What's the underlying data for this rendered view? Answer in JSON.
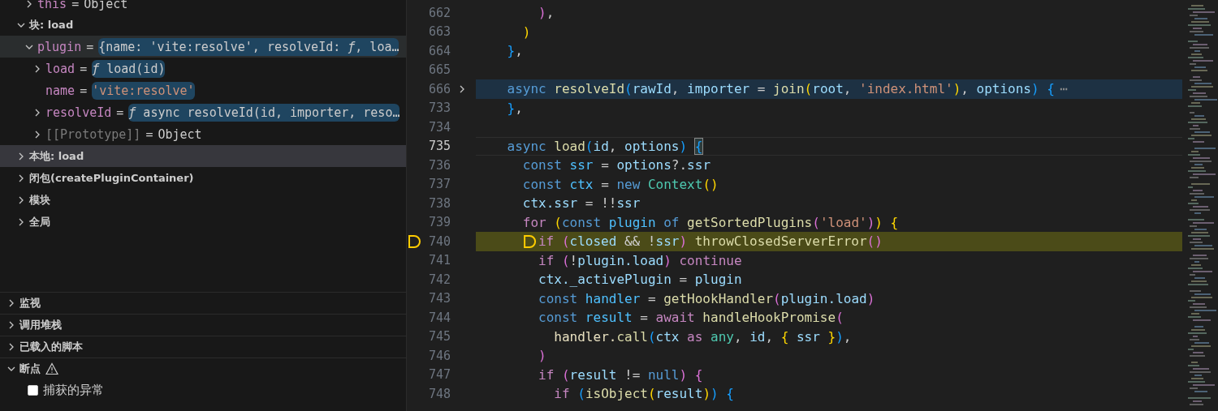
{
  "variables": {
    "previous_scope_rows": [
      {
        "kind": "object",
        "name": "this",
        "operator": "=",
        "value": "Object",
        "expanded": false,
        "highlighted": false
      }
    ],
    "rows": [
      {
        "kind": "scope",
        "label": "块: load",
        "expanded": true,
        "selected": false,
        "children": [
          {
            "kind": "object",
            "name": "plugin",
            "operator": "=",
            "value": "{name: 'vite:resolve', resolveId: *ƒ*, loa…",
            "expanded": true,
            "highlighted": true,
            "hovered": true,
            "children": [
              {
                "kind": "function",
                "name": "load",
                "operator": "=",
                "value": "*ƒ* load(id)",
                "expanded": false,
                "highlighted": true,
                "hovered": false
              },
              {
                "kind": "string",
                "name": "name",
                "operator": "=",
                "value": "'vite:resolve'",
                "highlighted": true,
                "hovered": false
              },
              {
                "kind": "function",
                "name": "resolveId",
                "operator": "=",
                "value": "*ƒ* async resolveId(id, importer, reso…",
                "expanded": false,
                "highlighted": true,
                "hovered": false
              },
              {
                "kind": "object",
                "name": "[[Prototype]]",
                "operator": "=",
                "value": "Object",
                "expanded": false,
                "highlighted": false,
                "hovered": false,
                "dim": true
              }
            ]
          }
        ]
      },
      {
        "kind": "scope",
        "label": "本地: load",
        "expanded": false,
        "selected": true
      },
      {
        "kind": "scope",
        "label": "闭包(createPluginContainer)",
        "expanded": false,
        "selected": false
      },
      {
        "kind": "scope",
        "label": "模块",
        "expanded": false,
        "selected": false
      },
      {
        "kind": "scope",
        "label": "全局",
        "expanded": false,
        "selected": false
      }
    ]
  },
  "sections": [
    {
      "title": "监视",
      "expanded": false,
      "warning": false
    },
    {
      "title": "调用堆栈",
      "expanded": false,
      "warning": false
    },
    {
      "title": "已载入的脚本",
      "expanded": false,
      "warning": false
    },
    {
      "title": "断点",
      "expanded": true,
      "warning": true,
      "items": [
        {
          "label": "捕获的异常",
          "checked": false
        }
      ]
    }
  ],
  "editor": {
    "lines": [
      {
        "number": "662",
        "tokens": [
          {
            "text": "        )",
            "color": "#da70d6"
          },
          {
            "text": ",",
            "color": "#cccccc"
          }
        ]
      },
      {
        "number": "663",
        "tokens": [
          {
            "text": "      )",
            "color": "#ffd700"
          }
        ]
      },
      {
        "number": "664",
        "tokens": [
          {
            "text": "    }",
            "color": "#179fff"
          },
          {
            "text": ",",
            "color": "#cccccc"
          }
        ]
      },
      {
        "number": "665"
      },
      {
        "number": "666",
        "folded": true,
        "fold_ellipsis": "⋯",
        "tokens": [
          {
            "text": "    async ",
            "color": "#569cd6"
          },
          {
            "text": "resolveId",
            "color": "#dcdcaa"
          },
          {
            "text": "(",
            "color": "#179fff"
          },
          {
            "text": "rawId",
            "color": "#9cdcfe"
          },
          {
            "text": ", ",
            "color": "#cccccc"
          },
          {
            "text": "importer",
            "color": "#9cdcfe"
          },
          {
            "text": " = ",
            "color": "#cccccc"
          },
          {
            "text": "join",
            "color": "#dcdcaa"
          },
          {
            "text": "(",
            "color": "#ffd700"
          },
          {
            "text": "root",
            "color": "#9cdcfe"
          },
          {
            "text": ", ",
            "color": "#cccccc"
          },
          {
            "text": "'index.html'",
            "color": "#ce9178"
          },
          {
            "text": ")",
            "color": "#ffd700"
          },
          {
            "text": ", ",
            "color": "#cccccc"
          },
          {
            "text": "options",
            "color": "#9cdcfe"
          },
          {
            "text": ") ",
            "color": "#179fff"
          },
          {
            "text": "{",
            "color": "#179fff"
          }
        ]
      },
      {
        "number": "733",
        "tokens": [
          {
            "text": "    }",
            "color": "#179fff"
          },
          {
            "text": ",",
            "color": "#cccccc"
          }
        ]
      },
      {
        "number": "734"
      },
      {
        "number": "735",
        "current": true,
        "tokens": [
          {
            "text": "    async ",
            "color": "#569cd6"
          },
          {
            "text": "load",
            "color": "#dcdcaa"
          },
          {
            "text": "(",
            "color": "#179fff"
          },
          {
            "text": "id",
            "color": "#9cdcfe"
          },
          {
            "text": ", ",
            "color": "#cccccc"
          },
          {
            "text": "options",
            "color": "#9cdcfe"
          },
          {
            "text": ") ",
            "color": "#179fff"
          },
          {
            "text": "{",
            "color": "#179fff",
            "bracket_match": true
          }
        ]
      },
      {
        "number": "736",
        "tokens": [
          {
            "text": "      const ",
            "color": "#569cd6"
          },
          {
            "text": "ssr",
            "color": "#4fc1ff"
          },
          {
            "text": " = ",
            "color": "#cccccc"
          },
          {
            "text": "options",
            "color": "#9cdcfe"
          },
          {
            "text": "?.",
            "color": "#cccccc"
          },
          {
            "text": "ssr",
            "color": "#9cdcfe"
          }
        ]
      },
      {
        "number": "737",
        "tokens": [
          {
            "text": "      const ",
            "color": "#569cd6"
          },
          {
            "text": "ctx",
            "color": "#4fc1ff"
          },
          {
            "text": " = ",
            "color": "#cccccc"
          },
          {
            "text": "new ",
            "color": "#569cd6"
          },
          {
            "text": "Context",
            "color": "#4ec9b0"
          },
          {
            "text": "()",
            "color": "#ffd700"
          }
        ]
      },
      {
        "number": "738",
        "tokens": [
          {
            "text": "      ctx.",
            "color": "#9cdcfe"
          },
          {
            "text": "ssr",
            "color": "#9cdcfe"
          },
          {
            "text": " = !!",
            "color": "#cccccc"
          },
          {
            "text": "ssr",
            "color": "#9cdcfe"
          }
        ]
      },
      {
        "number": "739",
        "tokens": [
          {
            "text": "      for ",
            "color": "#c586c0"
          },
          {
            "text": "(",
            "color": "#ffd700"
          },
          {
            "text": "const ",
            "color": "#569cd6"
          },
          {
            "text": "plugin ",
            "color": "#4fc1ff"
          },
          {
            "text": "of ",
            "color": "#569cd6"
          },
          {
            "text": "getSortedPlugins",
            "color": "#dcdcaa"
          },
          {
            "text": "(",
            "color": "#da70d6"
          },
          {
            "text": "'load'",
            "color": "#ce9178"
          },
          {
            "text": ")",
            "color": "#da70d6"
          },
          {
            "text": ") {",
            "color": "#ffd700"
          }
        ]
      },
      {
        "number": "740",
        "breakpoint": true,
        "paused": true,
        "inline_breakpoint": true,
        "tokens": [
          {
            "text": "      if ",
            "color": "#c586c0"
          },
          {
            "text": "(",
            "color": "#da70d6"
          },
          {
            "text": "closed",
            "color": "#9cdcfe"
          },
          {
            "text": " && !",
            "color": "#cccccc"
          },
          {
            "text": "ssr",
            "color": "#9cdcfe"
          },
          {
            "text": ") ",
            "color": "#da70d6"
          },
          {
            "text": "throwClosedServerError",
            "color": "#dcdcaa"
          },
          {
            "text": "()",
            "color": "#da70d6"
          }
        ]
      },
      {
        "number": "741",
        "tokens": [
          {
            "text": "        if ",
            "color": "#c586c0"
          },
          {
            "text": "(",
            "color": "#da70d6"
          },
          {
            "text": "!",
            "color": "#cccccc"
          },
          {
            "text": "plugin.",
            "color": "#9cdcfe"
          },
          {
            "text": "load",
            "color": "#9cdcfe"
          },
          {
            "text": ") ",
            "color": "#da70d6"
          },
          {
            "text": "continue",
            "color": "#c586c0"
          }
        ]
      },
      {
        "number": "742",
        "tokens": [
          {
            "text": "        ctx.",
            "color": "#9cdcfe"
          },
          {
            "text": "_activePlugin",
            "color": "#9cdcfe"
          },
          {
            "text": " = ",
            "color": "#cccccc"
          },
          {
            "text": "plugin",
            "color": "#9cdcfe"
          }
        ]
      },
      {
        "number": "743",
        "tokens": [
          {
            "text": "        const ",
            "color": "#569cd6"
          },
          {
            "text": "handler",
            "color": "#4fc1ff"
          },
          {
            "text": " = ",
            "color": "#cccccc"
          },
          {
            "text": "getHookHandler",
            "color": "#dcdcaa"
          },
          {
            "text": "(",
            "color": "#da70d6"
          },
          {
            "text": "plugin.",
            "color": "#9cdcfe"
          },
          {
            "text": "load",
            "color": "#9cdcfe"
          },
          {
            "text": ")",
            "color": "#da70d6"
          }
        ]
      },
      {
        "number": "744",
        "tokens": [
          {
            "text": "        const ",
            "color": "#569cd6"
          },
          {
            "text": "result",
            "color": "#4fc1ff"
          },
          {
            "text": " = ",
            "color": "#cccccc"
          },
          {
            "text": "await ",
            "color": "#c586c0"
          },
          {
            "text": "handleHookPromise",
            "color": "#dcdcaa"
          },
          {
            "text": "(",
            "color": "#da70d6"
          }
        ]
      },
      {
        "number": "745",
        "tokens": [
          {
            "text": "          handler.",
            "color": "#e8e0c0"
          },
          {
            "text": "call",
            "color": "#dcdcaa"
          },
          {
            "text": "(",
            "color": "#179fff"
          },
          {
            "text": "ctx ",
            "color": "#9cdcfe"
          },
          {
            "text": "as ",
            "color": "#c586c0"
          },
          {
            "text": "any",
            "color": "#4ec9b0"
          },
          {
            "text": ", ",
            "color": "#cccccc"
          },
          {
            "text": "id",
            "color": "#9cdcfe"
          },
          {
            "text": ", ",
            "color": "#cccccc"
          },
          {
            "text": "{ ",
            "color": "#ffd700"
          },
          {
            "text": "ssr ",
            "color": "#9cdcfe"
          },
          {
            "text": "}",
            "color": "#ffd700"
          },
          {
            "text": ")",
            "color": "#179fff"
          },
          {
            "text": ",",
            "color": "#cccccc"
          }
        ]
      },
      {
        "number": "746",
        "tokens": [
          {
            "text": "        )",
            "color": "#da70d6"
          }
        ]
      },
      {
        "number": "747",
        "tokens": [
          {
            "text": "        if ",
            "color": "#c586c0"
          },
          {
            "text": "(",
            "color": "#da70d6"
          },
          {
            "text": "result",
            "color": "#9cdcfe"
          },
          {
            "text": " != ",
            "color": "#cccccc"
          },
          {
            "text": "null",
            "color": "#569cd6"
          },
          {
            "text": ") {",
            "color": "#da70d6"
          }
        ]
      },
      {
        "number": "748",
        "tokens": [
          {
            "text": "          if ",
            "color": "#c586c0"
          },
          {
            "text": "(",
            "color": "#179fff"
          },
          {
            "text": "isObject",
            "color": "#dcdcaa"
          },
          {
            "text": "(",
            "color": "#ffd700"
          },
          {
            "text": "result",
            "color": "#9cdcfe"
          },
          {
            "text": ")",
            "color": "#ffd700"
          },
          {
            "text": ") {",
            "color": "#179fff"
          }
        ]
      }
    ]
  }
}
